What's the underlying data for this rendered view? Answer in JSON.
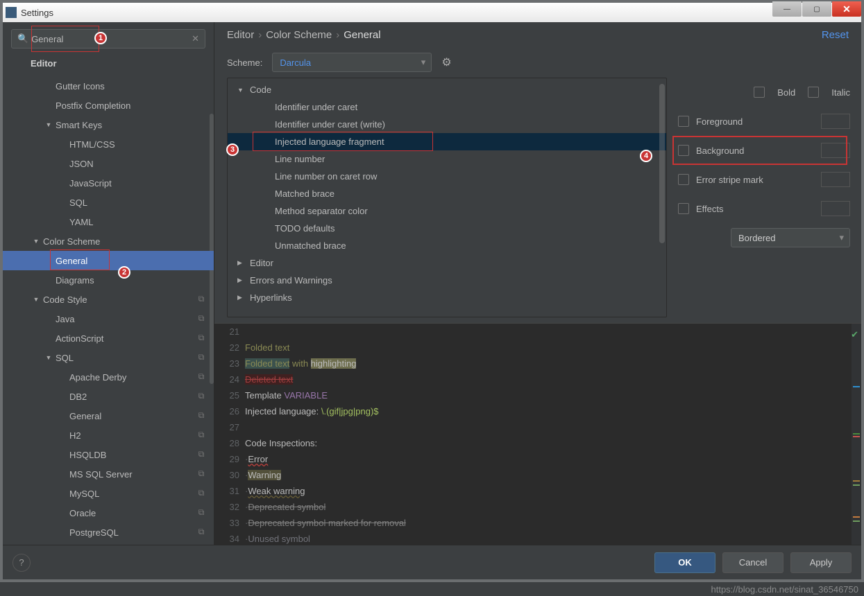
{
  "window_title": "Settings",
  "search_value": "General",
  "sidebar_header": "Editor",
  "sidebar": {
    "items": [
      {
        "label": "Gutter Icons",
        "indent": 76,
        "chev": "",
        "bold": false,
        "copy": false
      },
      {
        "label": "Postfix Completion",
        "indent": 76,
        "chev": "",
        "bold": false,
        "copy": false
      },
      {
        "label": "Smart Keys",
        "indent": 60,
        "chev": "▼",
        "bold": false,
        "copy": false
      },
      {
        "label": "HTML/CSS",
        "indent": 96,
        "chev": "",
        "bold": false,
        "copy": false
      },
      {
        "label": "JSON",
        "indent": 96,
        "chev": "",
        "bold": false,
        "copy": false
      },
      {
        "label": "JavaScript",
        "indent": 96,
        "chev": "",
        "bold": false,
        "copy": false
      },
      {
        "label": "SQL",
        "indent": 96,
        "chev": "",
        "bold": false,
        "copy": false
      },
      {
        "label": "YAML",
        "indent": 96,
        "chev": "",
        "bold": false,
        "copy": false
      },
      {
        "label": "Color Scheme",
        "indent": 42,
        "chev": "▼",
        "bold": false,
        "copy": false
      },
      {
        "label": "General",
        "indent": 76,
        "chev": "",
        "bold": false,
        "copy": false,
        "selected": true
      },
      {
        "label": "Diagrams",
        "indent": 76,
        "chev": "",
        "bold": false,
        "copy": false
      },
      {
        "label": "Code Style",
        "indent": 42,
        "chev": "▼",
        "bold": false,
        "copy": true
      },
      {
        "label": "Java",
        "indent": 76,
        "chev": "",
        "bold": false,
        "copy": true
      },
      {
        "label": "ActionScript",
        "indent": 76,
        "chev": "",
        "bold": false,
        "copy": true
      },
      {
        "label": "SQL",
        "indent": 60,
        "chev": "▼",
        "bold": false,
        "copy": true
      },
      {
        "label": "Apache Derby",
        "indent": 96,
        "chev": "",
        "bold": false,
        "copy": true
      },
      {
        "label": "DB2",
        "indent": 96,
        "chev": "",
        "bold": false,
        "copy": true
      },
      {
        "label": "General",
        "indent": 96,
        "chev": "",
        "bold": false,
        "copy": true
      },
      {
        "label": "H2",
        "indent": 96,
        "chev": "",
        "bold": false,
        "copy": true
      },
      {
        "label": "HSQLDB",
        "indent": 96,
        "chev": "",
        "bold": false,
        "copy": true
      },
      {
        "label": "MS SQL Server",
        "indent": 96,
        "chev": "",
        "bold": false,
        "copy": true
      },
      {
        "label": "MySQL",
        "indent": 96,
        "chev": "",
        "bold": false,
        "copy": true
      },
      {
        "label": "Oracle",
        "indent": 96,
        "chev": "",
        "bold": false,
        "copy": true
      },
      {
        "label": "PostgreSQL",
        "indent": 96,
        "chev": "",
        "bold": false,
        "copy": true
      }
    ]
  },
  "breadcrumb": {
    "a": "Editor",
    "b": "Color Scheme",
    "c": "General",
    "reset": "Reset"
  },
  "scheme": {
    "label": "Scheme:",
    "value": "Darcula"
  },
  "tree": [
    {
      "label": "Code",
      "chev": "▼",
      "child": false
    },
    {
      "label": "Identifier under caret",
      "chev": "",
      "child": true
    },
    {
      "label": "Identifier under caret (write)",
      "chev": "",
      "child": true
    },
    {
      "label": "Injected language fragment",
      "chev": "",
      "child": true,
      "selected": true
    },
    {
      "label": "Line number",
      "chev": "",
      "child": true
    },
    {
      "label": "Line number on caret row",
      "chev": "",
      "child": true
    },
    {
      "label": "Matched brace",
      "chev": "",
      "child": true
    },
    {
      "label": "Method separator color",
      "chev": "",
      "child": true
    },
    {
      "label": "TODO defaults",
      "chev": "",
      "child": true
    },
    {
      "label": "Unmatched brace",
      "chev": "",
      "child": true
    },
    {
      "label": "Editor",
      "chev": "▶",
      "child": false
    },
    {
      "label": "Errors and Warnings",
      "chev": "▶",
      "child": false
    },
    {
      "label": "Hyperlinks",
      "chev": "▶",
      "child": false
    }
  ],
  "props": {
    "bold": "Bold",
    "italic": "Italic",
    "foreground": "Foreground",
    "background": "Background",
    "errstripe": "Error stripe mark",
    "effects": "Effects",
    "effect_type": "Bordered"
  },
  "preview": {
    "start": 21,
    "lines": [
      "",
      "Folded text",
      "Folded text with highlighting",
      "Deleted text",
      "Template VARIABLE",
      "Injected language: \\.(gif|jpg|png)$",
      "",
      "Code Inspections:",
      " Error",
      " Warning",
      " Weak warning",
      " Deprecated symbol",
      " Deprecated symbol marked for removal",
      " Unused symbol"
    ]
  },
  "buttons": {
    "ok": "OK",
    "cancel": "Cancel",
    "apply": "Apply"
  },
  "watermark": "https://blog.csdn.net/sinat_36546750"
}
